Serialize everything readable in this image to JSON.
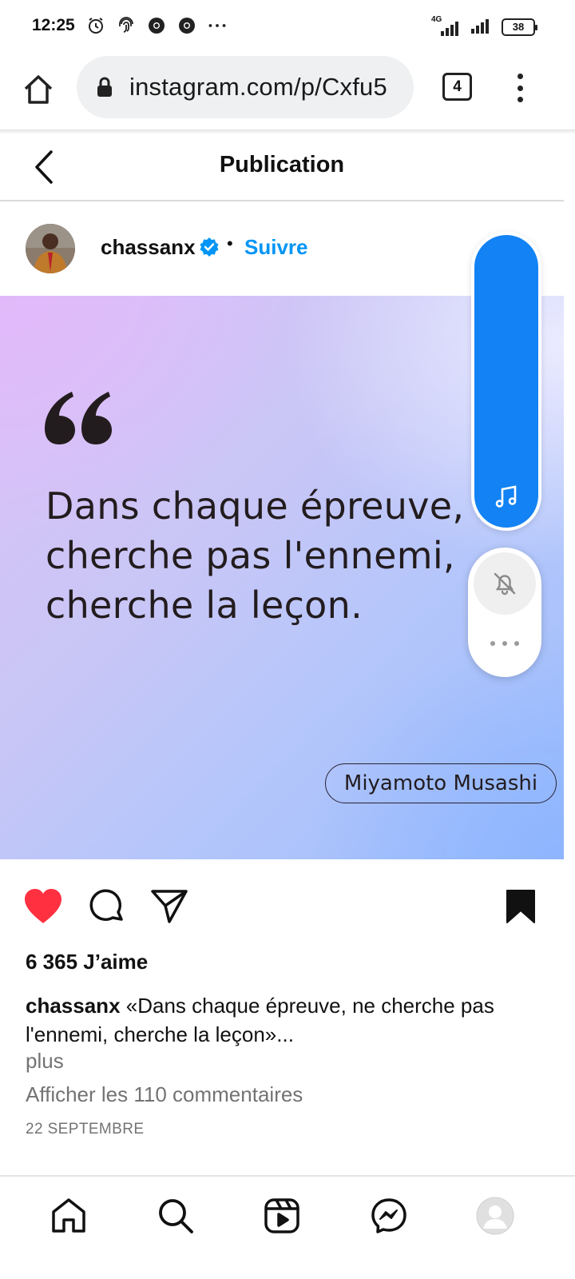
{
  "status_bar": {
    "time": "12:25",
    "network": "4G",
    "battery": "38",
    "icons": [
      "alarm-icon",
      "fingerprint-icon",
      "chrome-icon",
      "chrome-icon",
      "more-dots-icon",
      "signal-icon",
      "signal-icon",
      "battery-icon"
    ]
  },
  "browser": {
    "url": "instagram.com/p/Cxfu5",
    "tab_count": "4"
  },
  "page": {
    "title": "Publication"
  },
  "post": {
    "username": "chassanx",
    "separator": "•",
    "follow_label": "Suivre",
    "quote_lines": [
      "Dans chaque épreuve, ne",
      "cherche pas l'ennemi,",
      "cherche la leçon."
    ],
    "author": "Miyamoto Musashi",
    "likes": "6 365 J’aime",
    "caption_username": "chassanx",
    "caption_text": " «Dans chaque épreuve, ne cherche pas l'ennemi, cherche la leçon»...",
    "more_label": "plus",
    "comments_label": "Afficher les 110 commentaires",
    "date": "22 SEPTEMBRE",
    "liked": true,
    "saved": true
  },
  "colors": {
    "accent_blue": "#0095f6",
    "like_red": "#ff3040",
    "overlay_blue": "#1282f4"
  }
}
